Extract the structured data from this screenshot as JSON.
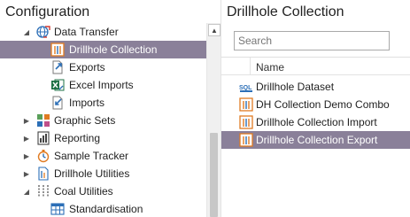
{
  "left_panel": {
    "title": "Configuration",
    "tree": [
      {
        "label": "Data Transfer",
        "expander": "◢",
        "icon": "globe-arrows-icon"
      },
      {
        "label": "Drillhole Collection",
        "icon": "drillhole-collection-icon",
        "selected": true
      },
      {
        "label": "Exports",
        "icon": "export-arrow-icon"
      },
      {
        "label": "Excel Imports",
        "icon": "excel-icon"
      },
      {
        "label": "Imports",
        "icon": "import-arrow-icon"
      },
      {
        "label": "Graphic Sets",
        "expander": "▶",
        "icon": "graphic-sets-icon"
      },
      {
        "label": "Reporting",
        "expander": "▶",
        "icon": "reporting-icon"
      },
      {
        "label": "Sample Tracker",
        "expander": "▶",
        "icon": "sample-tracker-icon"
      },
      {
        "label": "Drillhole Utilities",
        "expander": "▶",
        "icon": "drillhole-utilities-icon"
      },
      {
        "label": "Coal Utilities",
        "expander": "◢",
        "icon": "coal-utilities-icon"
      },
      {
        "label": "Standardisation",
        "icon": "table-grid-icon"
      }
    ],
    "scroll_up_glyph": "▲"
  },
  "right_panel": {
    "title": "Drillhole Collection",
    "search": {
      "placeholder": "Search",
      "value": ""
    },
    "column_header": "Name",
    "items": [
      {
        "label": "Drillhole Dataset",
        "icon": "sql-dataset-icon"
      },
      {
        "label": "DH Collection Demo Combo",
        "icon": "collection-combo-icon"
      },
      {
        "label": "Drillhole Collection Import",
        "icon": "collection-import-icon"
      },
      {
        "label": "Drillhole Collection Export",
        "icon": "collection-export-icon",
        "selected": true
      }
    ]
  },
  "colors": {
    "selection": "#8a8099",
    "accent_orange": "#e07b22",
    "accent_blue": "#2c6fb7"
  }
}
